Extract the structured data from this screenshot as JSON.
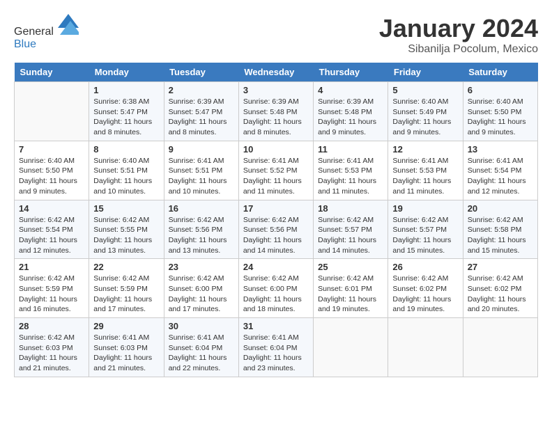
{
  "header": {
    "logo_general": "General",
    "logo_blue": "Blue",
    "month_title": "January 2024",
    "location": "Sibanilja Pocolum, Mexico"
  },
  "days_of_week": [
    "Sunday",
    "Monday",
    "Tuesday",
    "Wednesday",
    "Thursday",
    "Friday",
    "Saturday"
  ],
  "weeks": [
    [
      {
        "day": "",
        "sunrise": "",
        "sunset": "",
        "daylight": ""
      },
      {
        "day": "1",
        "sunrise": "Sunrise: 6:38 AM",
        "sunset": "Sunset: 5:47 PM",
        "daylight": "Daylight: 11 hours and 8 minutes."
      },
      {
        "day": "2",
        "sunrise": "Sunrise: 6:39 AM",
        "sunset": "Sunset: 5:47 PM",
        "daylight": "Daylight: 11 hours and 8 minutes."
      },
      {
        "day": "3",
        "sunrise": "Sunrise: 6:39 AM",
        "sunset": "Sunset: 5:48 PM",
        "daylight": "Daylight: 11 hours and 8 minutes."
      },
      {
        "day": "4",
        "sunrise": "Sunrise: 6:39 AM",
        "sunset": "Sunset: 5:48 PM",
        "daylight": "Daylight: 11 hours and 9 minutes."
      },
      {
        "day": "5",
        "sunrise": "Sunrise: 6:40 AM",
        "sunset": "Sunset: 5:49 PM",
        "daylight": "Daylight: 11 hours and 9 minutes."
      },
      {
        "day": "6",
        "sunrise": "Sunrise: 6:40 AM",
        "sunset": "Sunset: 5:50 PM",
        "daylight": "Daylight: 11 hours and 9 minutes."
      }
    ],
    [
      {
        "day": "7",
        "sunrise": "Sunrise: 6:40 AM",
        "sunset": "Sunset: 5:50 PM",
        "daylight": "Daylight: 11 hours and 9 minutes."
      },
      {
        "day": "8",
        "sunrise": "Sunrise: 6:40 AM",
        "sunset": "Sunset: 5:51 PM",
        "daylight": "Daylight: 11 hours and 10 minutes."
      },
      {
        "day": "9",
        "sunrise": "Sunrise: 6:41 AM",
        "sunset": "Sunset: 5:51 PM",
        "daylight": "Daylight: 11 hours and 10 minutes."
      },
      {
        "day": "10",
        "sunrise": "Sunrise: 6:41 AM",
        "sunset": "Sunset: 5:52 PM",
        "daylight": "Daylight: 11 hours and 11 minutes."
      },
      {
        "day": "11",
        "sunrise": "Sunrise: 6:41 AM",
        "sunset": "Sunset: 5:53 PM",
        "daylight": "Daylight: 11 hours and 11 minutes."
      },
      {
        "day": "12",
        "sunrise": "Sunrise: 6:41 AM",
        "sunset": "Sunset: 5:53 PM",
        "daylight": "Daylight: 11 hours and 11 minutes."
      },
      {
        "day": "13",
        "sunrise": "Sunrise: 6:41 AM",
        "sunset": "Sunset: 5:54 PM",
        "daylight": "Daylight: 11 hours and 12 minutes."
      }
    ],
    [
      {
        "day": "14",
        "sunrise": "Sunrise: 6:42 AM",
        "sunset": "Sunset: 5:54 PM",
        "daylight": "Daylight: 11 hours and 12 minutes."
      },
      {
        "day": "15",
        "sunrise": "Sunrise: 6:42 AM",
        "sunset": "Sunset: 5:55 PM",
        "daylight": "Daylight: 11 hours and 13 minutes."
      },
      {
        "day": "16",
        "sunrise": "Sunrise: 6:42 AM",
        "sunset": "Sunset: 5:56 PM",
        "daylight": "Daylight: 11 hours and 13 minutes."
      },
      {
        "day": "17",
        "sunrise": "Sunrise: 6:42 AM",
        "sunset": "Sunset: 5:56 PM",
        "daylight": "Daylight: 11 hours and 14 minutes."
      },
      {
        "day": "18",
        "sunrise": "Sunrise: 6:42 AM",
        "sunset": "Sunset: 5:57 PM",
        "daylight": "Daylight: 11 hours and 14 minutes."
      },
      {
        "day": "19",
        "sunrise": "Sunrise: 6:42 AM",
        "sunset": "Sunset: 5:57 PM",
        "daylight": "Daylight: 11 hours and 15 minutes."
      },
      {
        "day": "20",
        "sunrise": "Sunrise: 6:42 AM",
        "sunset": "Sunset: 5:58 PM",
        "daylight": "Daylight: 11 hours and 15 minutes."
      }
    ],
    [
      {
        "day": "21",
        "sunrise": "Sunrise: 6:42 AM",
        "sunset": "Sunset: 5:59 PM",
        "daylight": "Daylight: 11 hours and 16 minutes."
      },
      {
        "day": "22",
        "sunrise": "Sunrise: 6:42 AM",
        "sunset": "Sunset: 5:59 PM",
        "daylight": "Daylight: 11 hours and 17 minutes."
      },
      {
        "day": "23",
        "sunrise": "Sunrise: 6:42 AM",
        "sunset": "Sunset: 6:00 PM",
        "daylight": "Daylight: 11 hours and 17 minutes."
      },
      {
        "day": "24",
        "sunrise": "Sunrise: 6:42 AM",
        "sunset": "Sunset: 6:00 PM",
        "daylight": "Daylight: 11 hours and 18 minutes."
      },
      {
        "day": "25",
        "sunrise": "Sunrise: 6:42 AM",
        "sunset": "Sunset: 6:01 PM",
        "daylight": "Daylight: 11 hours and 19 minutes."
      },
      {
        "day": "26",
        "sunrise": "Sunrise: 6:42 AM",
        "sunset": "Sunset: 6:02 PM",
        "daylight": "Daylight: 11 hours and 19 minutes."
      },
      {
        "day": "27",
        "sunrise": "Sunrise: 6:42 AM",
        "sunset": "Sunset: 6:02 PM",
        "daylight": "Daylight: 11 hours and 20 minutes."
      }
    ],
    [
      {
        "day": "28",
        "sunrise": "Sunrise: 6:42 AM",
        "sunset": "Sunset: 6:03 PM",
        "daylight": "Daylight: 11 hours and 21 minutes."
      },
      {
        "day": "29",
        "sunrise": "Sunrise: 6:41 AM",
        "sunset": "Sunset: 6:03 PM",
        "daylight": "Daylight: 11 hours and 21 minutes."
      },
      {
        "day": "30",
        "sunrise": "Sunrise: 6:41 AM",
        "sunset": "Sunset: 6:04 PM",
        "daylight": "Daylight: 11 hours and 22 minutes."
      },
      {
        "day": "31",
        "sunrise": "Sunrise: 6:41 AM",
        "sunset": "Sunset: 6:04 PM",
        "daylight": "Daylight: 11 hours and 23 minutes."
      },
      {
        "day": "",
        "sunrise": "",
        "sunset": "",
        "daylight": ""
      },
      {
        "day": "",
        "sunrise": "",
        "sunset": "",
        "daylight": ""
      },
      {
        "day": "",
        "sunrise": "",
        "sunset": "",
        "daylight": ""
      }
    ]
  ]
}
